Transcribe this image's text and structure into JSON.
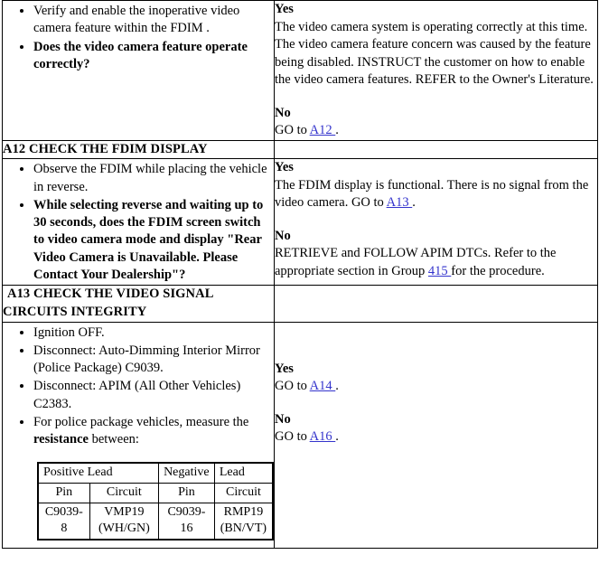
{
  "document": {
    "type": "pinpoint-test-table",
    "link_color": "#3333cc",
    "text_color": "#000000",
    "background": "#ffffff"
  },
  "rows": [
    {
      "id": "a11-continuation",
      "has_title": false,
      "actions": [
        {
          "text": "Verify and enable the inoperative video camera feature within the FDIM .",
          "bold": false
        },
        {
          "text": "Does the video camera feature operate correctly?",
          "bold": true
        }
      ],
      "results": {
        "yes_label": "Yes",
        "yes_text": "The video camera system is operating correctly at this time. The video camera feature concern was caused by the feature being disabled. INSTRUCT the customer on how to enable the video camera features. REFER to the Owner's Literature.",
        "no_label": "No",
        "no_prefix": "GO to ",
        "no_link": "A12 ",
        "no_suffix": "."
      }
    },
    {
      "id": "a12",
      "has_title": true,
      "title": "A12 CHECK THE FDIM DISPLAY",
      "actions": [
        {
          "text": "Observe the FDIM while placing the vehicle in reverse.",
          "bold": false
        },
        {
          "text": "While selecting reverse and waiting up to 30 seconds, does the FDIM screen switch to video camera mode and display \"Rear Video Camera is Unavailable. Please Contact Your Dealership\"?",
          "bold": true
        }
      ],
      "results": {
        "yes_label": "Yes",
        "yes_prefix": "The FDIM display is functional. There is no signal from the video camera. GO to ",
        "yes_link": "A13 ",
        "yes_suffix": ".",
        "no_label": "No",
        "no_prefix": "RETRIEVE and FOLLOW APIM DTCs. Refer to the appropriate section in Group ",
        "no_link": "415 ",
        "no_suffix": "for the procedure."
      }
    },
    {
      "id": "a13",
      "has_title": true,
      "title_line1": "A13 CHECK THE VIDEO SIGNAL",
      "title_line2": "CIRCUITS INTEGRITY",
      "actions": [
        {
          "text": "Ignition OFF.",
          "bold": false
        },
        {
          "text": "Disconnect: Auto-Dimming Interior Mirror (Police Package) C9039.",
          "bold": false
        },
        {
          "text": "Disconnect: APIM (All Other Vehicles) C2383.",
          "bold": false
        },
        {
          "text": "For police package vehicles, measure the resistance between:",
          "bold": false,
          "bold_word": "resistance"
        }
      ],
      "results": {
        "yes_label": "Yes",
        "yes_prefix": "GO to ",
        "yes_link": "A14 ",
        "yes_suffix": ".",
        "no_label": "No",
        "no_prefix": "GO to ",
        "no_link": "A16 ",
        "no_suffix": "."
      }
    }
  ],
  "leads_table": {
    "group_headers": [
      "Positive Lead",
      "Negative",
      "Lead"
    ],
    "column_headers": [
      "Pin",
      "Circuit",
      "Pin",
      "Circuit"
    ],
    "data_rows": [
      [
        "C9039-8",
        "VMP19 (WH/GN)",
        "C9039-16",
        "RMP19 (BN/VT)"
      ]
    ],
    "cells": {
      "r1c1": "C9039-8",
      "r1c2": "VMP19 (WH/GN)",
      "r1c3": "C9039-16",
      "r1c4": "RMP19 (BN/VT)"
    }
  }
}
